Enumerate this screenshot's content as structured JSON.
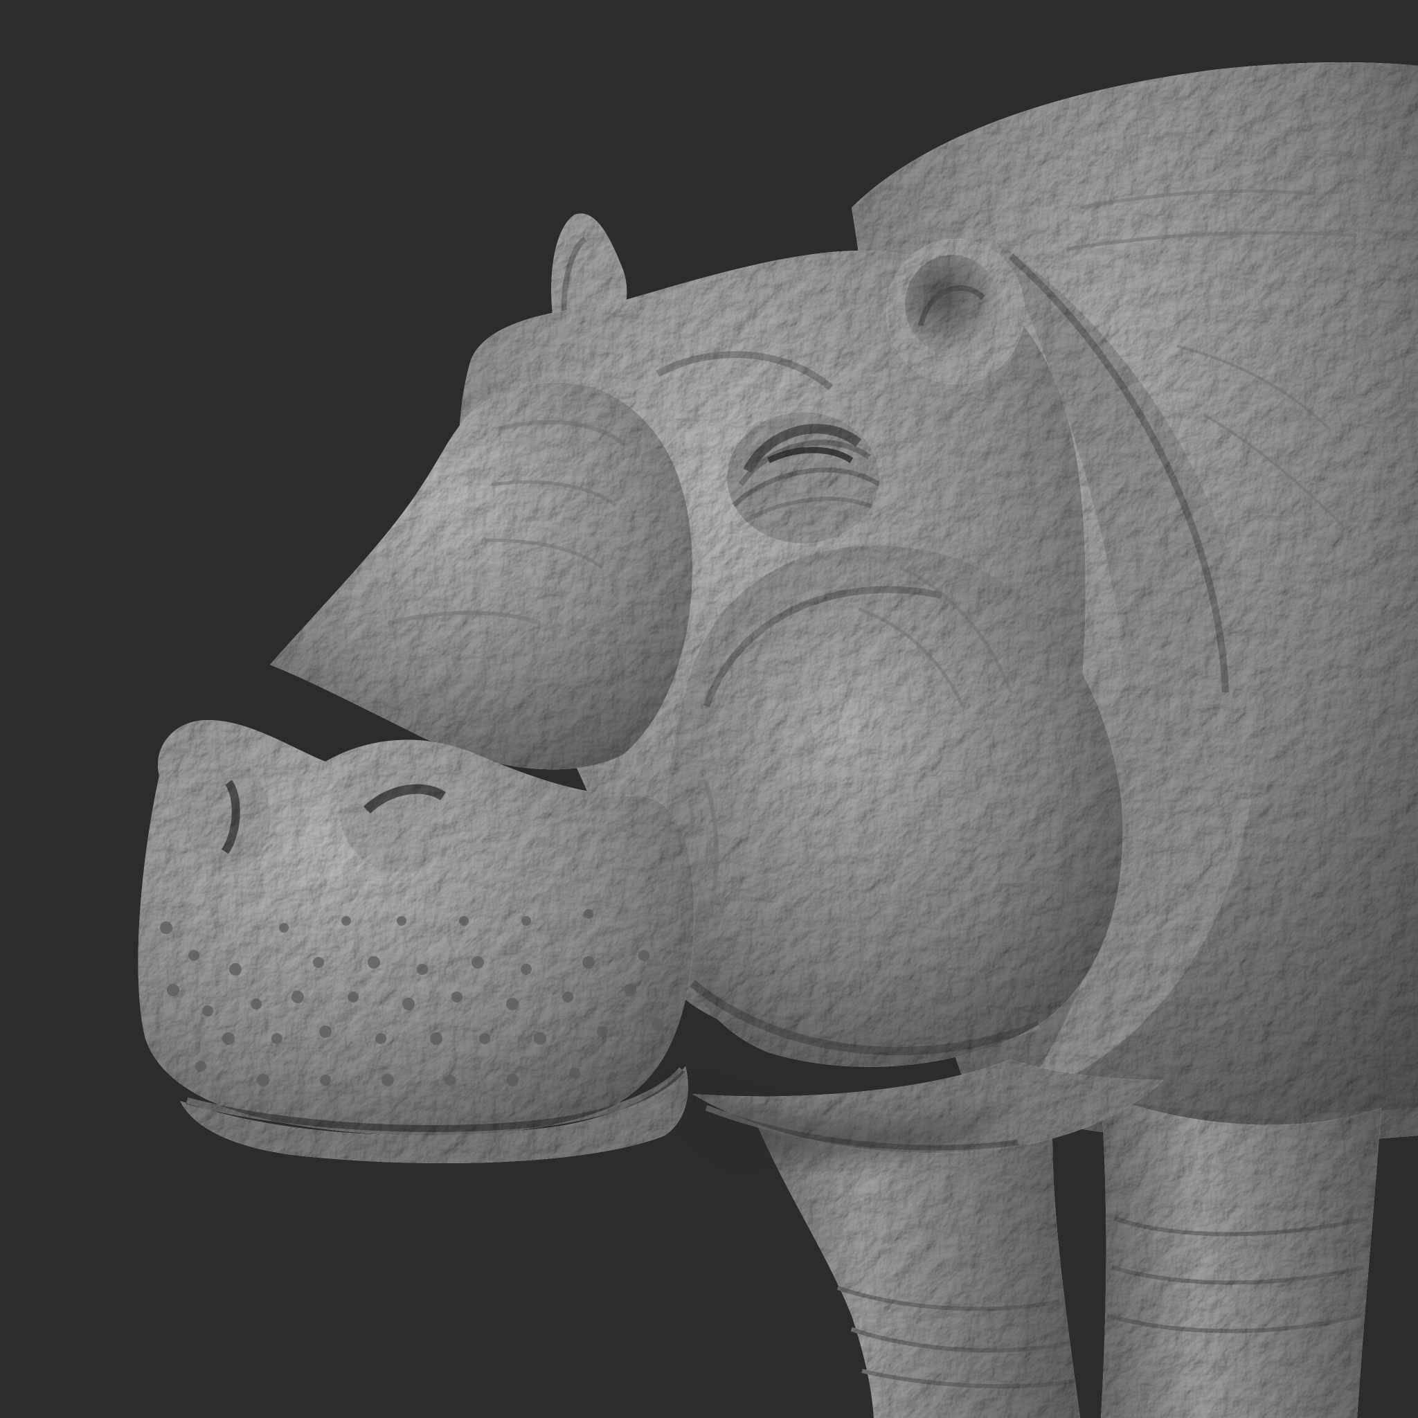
{
  "scene": {
    "subject": "hippopotamus-sculpt",
    "background_color": "#2c2c2c",
    "material_base_color": "#a9a9a9",
    "material_highlight_color": "#ececec",
    "material_shadow_color": "#4a4a4a"
  }
}
